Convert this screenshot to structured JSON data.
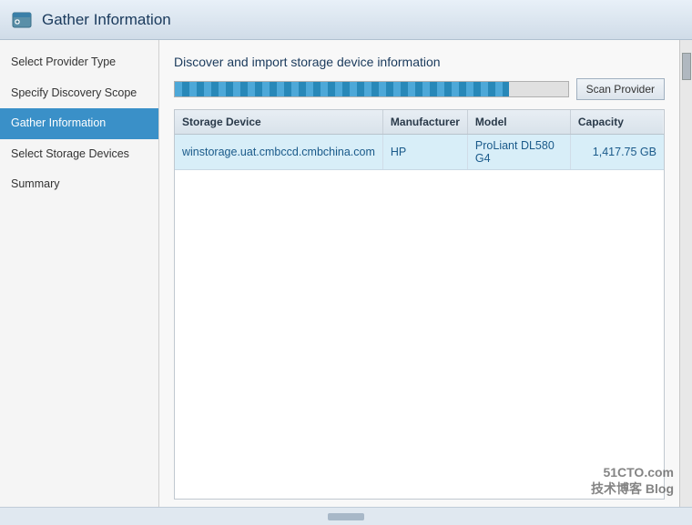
{
  "window": {
    "title": "Gather Information",
    "icon": "green-plus-icon"
  },
  "sidebar": {
    "items": [
      {
        "id": "select-provider-type",
        "label": "Select Provider Type",
        "active": false
      },
      {
        "id": "specify-discovery-scope",
        "label": "Specify Discovery Scope",
        "active": false
      },
      {
        "id": "gather-information",
        "label": "Gather Information",
        "active": true
      },
      {
        "id": "select-storage-devices",
        "label": "Select Storage Devices",
        "active": false
      },
      {
        "id": "summary",
        "label": "Summary",
        "active": false
      }
    ]
  },
  "main": {
    "title": "Discover and import storage device information",
    "scan_button_label": "Scan Provider",
    "progress_percent": 85,
    "table": {
      "columns": [
        {
          "id": "storage-device",
          "label": "Storage Device"
        },
        {
          "id": "manufacturer",
          "label": "Manufacturer"
        },
        {
          "id": "model",
          "label": "Model"
        },
        {
          "id": "capacity",
          "label": "Capacity"
        }
      ],
      "rows": [
        {
          "storage_device": "winstorage.uat.cmbccd.cmbchina.com",
          "manufacturer": "HP",
          "model": "ProLiant DL580 G4",
          "capacity": "1,417.75 GB"
        }
      ]
    }
  },
  "watermark": {
    "line1": "51CTO.com",
    "line2": "技术博客  Blog"
  }
}
